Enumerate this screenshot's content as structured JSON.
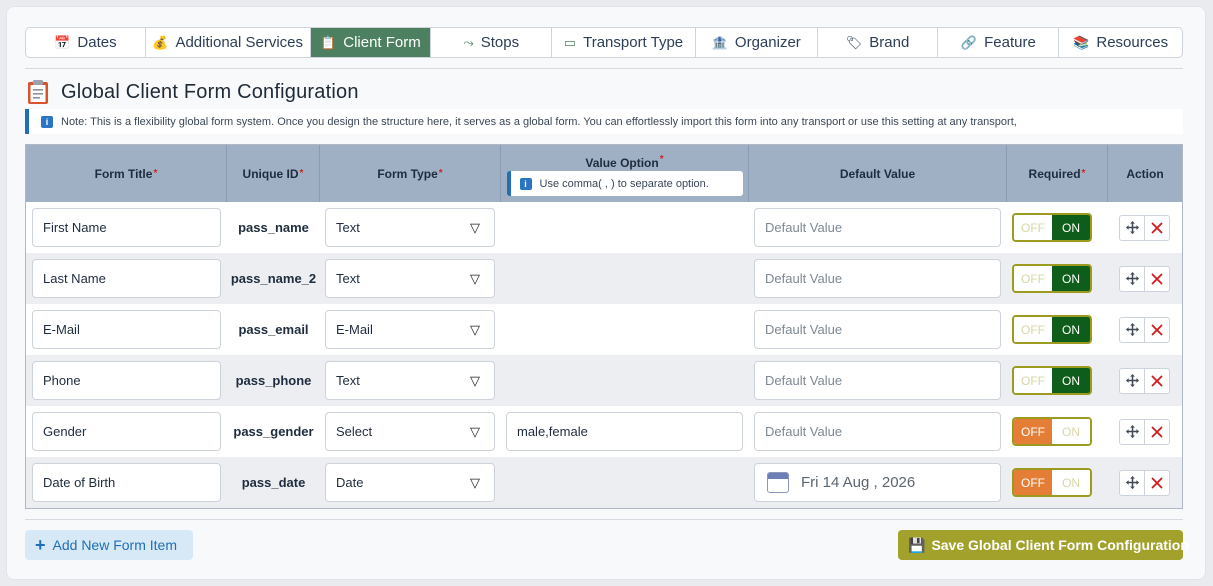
{
  "tabs": [
    {
      "label": "Dates",
      "icon": "calendar-icon"
    },
    {
      "label": "Additional Services",
      "icon": "money-bag-icon"
    },
    {
      "label": "Client Form",
      "icon": "clipboard-icon",
      "active": true
    },
    {
      "label": "Stops",
      "icon": "route-icon"
    },
    {
      "label": "Transport Type",
      "icon": "card-icon"
    },
    {
      "label": "Organizer",
      "icon": "building-icon"
    },
    {
      "label": "Brand",
      "icon": "tag-icon"
    },
    {
      "label": "Feature",
      "icon": "link-icon"
    },
    {
      "label": "Resources",
      "icon": "books-icon"
    }
  ],
  "page_title": "Global Client Form Configuration",
  "note": "Note: This is a flexibility global form system. Once you design the structure here, it serves as a global form. You can effortlessly import this form into any transport or use this setting at any transport,",
  "table": {
    "headers": {
      "form_title": "Form Title",
      "unique_id": "Unique ID",
      "form_type": "Form Type",
      "value_option": "Value Option",
      "value_option_note": "Use comma( , ) to separate option.",
      "default_value": "Default Value",
      "required": "Required",
      "action": "Action",
      "required_mark": "*"
    },
    "default_placeholder": "Default Value",
    "toggle_off": "OFF",
    "toggle_on": "ON",
    "rows": [
      {
        "title": "First Name",
        "uid": "pass_name",
        "type": "Text",
        "option": "",
        "required": "ON"
      },
      {
        "title": "Last Name",
        "uid": "pass_name_2",
        "type": "Text",
        "option": "",
        "required": "ON"
      },
      {
        "title": "E-Mail",
        "uid": "pass_email",
        "type": "E-Mail",
        "option": "",
        "required": "ON"
      },
      {
        "title": "Phone",
        "uid": "pass_phone",
        "type": "Text",
        "option": "",
        "required": "ON"
      },
      {
        "title": "Gender",
        "uid": "pass_gender",
        "type": "Select",
        "option": "male,female",
        "required": "OFF"
      },
      {
        "title": "Date of Birth",
        "uid": "pass_date",
        "type": "Date",
        "option": "",
        "required": "OFF",
        "date_value": "Fri 14 Aug , 2026"
      }
    ]
  },
  "add_button": "Add New Form Item",
  "save_button": "Save Global Client Form Configuration",
  "colors": {
    "accent_green": "#4d8060",
    "toggle_on": "#0f5d1b",
    "toggle_off": "#e47d35",
    "save": "#a1a12c",
    "info": "#1f6fb5"
  }
}
